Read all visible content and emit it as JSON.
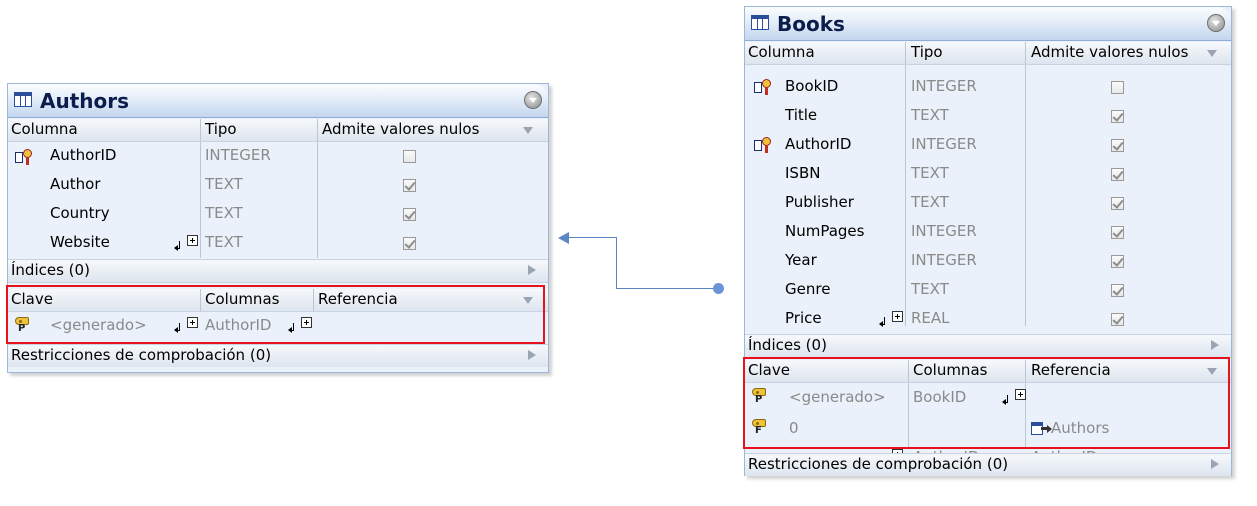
{
  "authors": {
    "title": "Authors",
    "col_headers": {
      "column": "Columna",
      "type": "Tipo",
      "nullable": "Admite valores nulos"
    },
    "rows": [
      {
        "name": "AuthorID",
        "type": "INTEGER",
        "nullable": false,
        "pk": true
      },
      {
        "name": "Author",
        "type": "TEXT",
        "nullable": true
      },
      {
        "name": "Country",
        "type": "TEXT",
        "nullable": true
      },
      {
        "name": "Website",
        "type": "TEXT",
        "nullable": true
      }
    ],
    "indexes_label": "Índices (0)",
    "keys_headers": {
      "key": "Clave",
      "columns": "Columnas",
      "reference": "Referencia"
    },
    "keys": [
      {
        "name": "<generado>",
        "column": "AuthorID",
        "kind": "P"
      }
    ],
    "checks_label": "Restricciones de comprobación (0)"
  },
  "books": {
    "title": "Books",
    "col_headers": {
      "column": "Columna",
      "type": "Tipo",
      "nullable": "Admite valores nulos"
    },
    "rows": [
      {
        "name": "BookID",
        "type": "INTEGER",
        "nullable": false,
        "pk": true
      },
      {
        "name": "Title",
        "type": "TEXT",
        "nullable": true
      },
      {
        "name": "AuthorID",
        "type": "INTEGER",
        "nullable": true,
        "pk": true
      },
      {
        "name": "ISBN",
        "type": "TEXT",
        "nullable": true
      },
      {
        "name": "Publisher",
        "type": "TEXT",
        "nullable": true
      },
      {
        "name": "NumPages",
        "type": "INTEGER",
        "nullable": true
      },
      {
        "name": "Year",
        "type": "INTEGER",
        "nullable": true
      },
      {
        "name": "Genre",
        "type": "TEXT",
        "nullable": true
      },
      {
        "name": "Price",
        "type": "REAL",
        "nullable": true
      }
    ],
    "indexes_label": "Índices (0)",
    "keys_headers": {
      "key": "Clave",
      "columns": "Columnas",
      "reference": "Referencia"
    },
    "keys": [
      {
        "name": "<generado>",
        "column": "BookID",
        "kind": "P"
      },
      {
        "name": "0",
        "kind": "F",
        "ref_table": "Authors",
        "column": "AuthorID",
        "ref_column": "AuthorID"
      }
    ],
    "checks_label": "Restricciones de comprobación (0)"
  },
  "colors": {
    "highlight": "#e8121c",
    "connector": "#5b86c4",
    "title_text": "#0b1d4d"
  }
}
